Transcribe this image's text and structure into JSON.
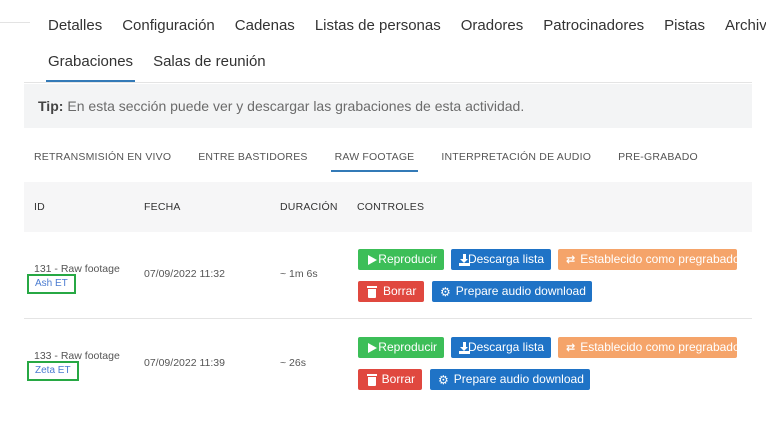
{
  "main_tabs": [
    {
      "label": "Detalles"
    },
    {
      "label": "Configuración"
    },
    {
      "label": "Cadenas"
    },
    {
      "label": "Listas de personas"
    },
    {
      "label": "Oradores"
    },
    {
      "label": "Patrocinadores"
    },
    {
      "label": "Pistas"
    },
    {
      "label": "Archivos"
    },
    {
      "label": "Grabaciones",
      "active": true
    },
    {
      "label": "Salas de reunión"
    }
  ],
  "tip": {
    "label": "Tip:",
    "text": "En esta sección puede ver y descargar las grabaciones de esta actividad."
  },
  "sub_tabs": [
    {
      "label": "RETRANSMISIÓN EN VIVO"
    },
    {
      "label": "ENTRE BASTIDORES"
    },
    {
      "label": "RAW FOOTAGE",
      "active": true
    },
    {
      "label": "INTERPRETACIÓN DE AUDIO"
    },
    {
      "label": "PRE-GRABADO"
    }
  ],
  "table": {
    "columns": {
      "id": "ID",
      "date": "FECHA",
      "duration": "DURACIÓN",
      "controls": "CONTROLES"
    },
    "rows": [
      {
        "title": "131 - Raw footage",
        "stream": "Ash ET",
        "date": "07/09/2022 11:32",
        "duration": "~ 1m 6s",
        "buttons": {
          "play": "Reproducir",
          "download": "Descarga lista",
          "set_prerecorded": "Establecido como pregrabado",
          "delete": "Borrar",
          "prepare_audio": "Prepare audio download"
        }
      },
      {
        "title": "133 - Raw footage",
        "stream": "Zeta ET",
        "date": "07/09/2022 11:39",
        "duration": "~ 26s",
        "buttons": {
          "play": "Reproducir",
          "download": "Descarga lista",
          "set_prerecorded": "Establecido como pregrabado",
          "delete": "Borrar",
          "prepare_audio": "Prepare audio download"
        }
      }
    ]
  },
  "icons": {
    "play": "play-icon",
    "download": "download-icon",
    "exchange": "exchange-icon",
    "delete": "trash-icon",
    "prepare": "gear-icon"
  },
  "colors": {
    "primary": "#1f73c6",
    "success": "#3cbe58",
    "warning": "#f5a46a",
    "danger": "#e0483f",
    "highlight": "#27a844"
  }
}
